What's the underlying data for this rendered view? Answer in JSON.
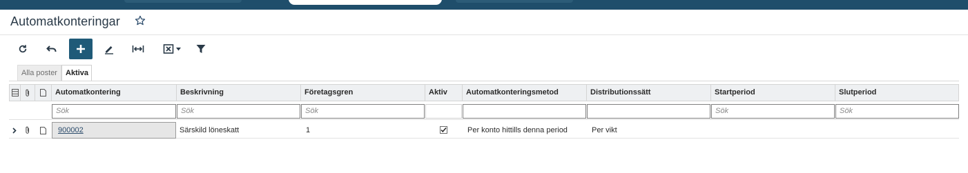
{
  "colors": {
    "topbar": "#1f4e6b",
    "primary_button": "#1f5a78",
    "header_bg": "#eef0f2",
    "key_cell_bg": "#e6e6e6"
  },
  "page": {
    "title": "Automatkonteringar",
    "favorite_icon": "star-outline-icon"
  },
  "toolbar": {
    "buttons": [
      {
        "name": "refresh",
        "icon": "refresh-icon"
      },
      {
        "name": "undo",
        "icon": "undo-icon"
      },
      {
        "name": "add",
        "icon": "plus-icon"
      },
      {
        "name": "edit",
        "icon": "pencil-icon"
      },
      {
        "name": "column-width",
        "icon": "fit-columns-icon"
      },
      {
        "name": "export-excel",
        "icon": "excel-icon",
        "has_dropdown": true
      },
      {
        "name": "filter",
        "icon": "filter-icon"
      }
    ]
  },
  "tabs": {
    "all": "Alla poster",
    "active": "Aktiva"
  },
  "table": {
    "columns": {
      "automatkontering": "Automatkontering",
      "beskrivning": "Beskrivning",
      "foretagsgren": "Företagsgren",
      "aktiv": "Aktiv",
      "metod": "Automatkonteringsmetod",
      "distribution": "Distributionssätt",
      "startperiod": "Startperiod",
      "slutperiod": "Slutperiod"
    },
    "filter_placeholder": "Sök",
    "rows": [
      {
        "automatkontering": "900002",
        "beskrivning": "Särskild löneskatt",
        "foretagsgren": "1",
        "aktiv": true,
        "metod": "Per konto hittills denna period",
        "distribution": "Per vikt",
        "startperiod": "",
        "slutperiod": ""
      }
    ]
  }
}
